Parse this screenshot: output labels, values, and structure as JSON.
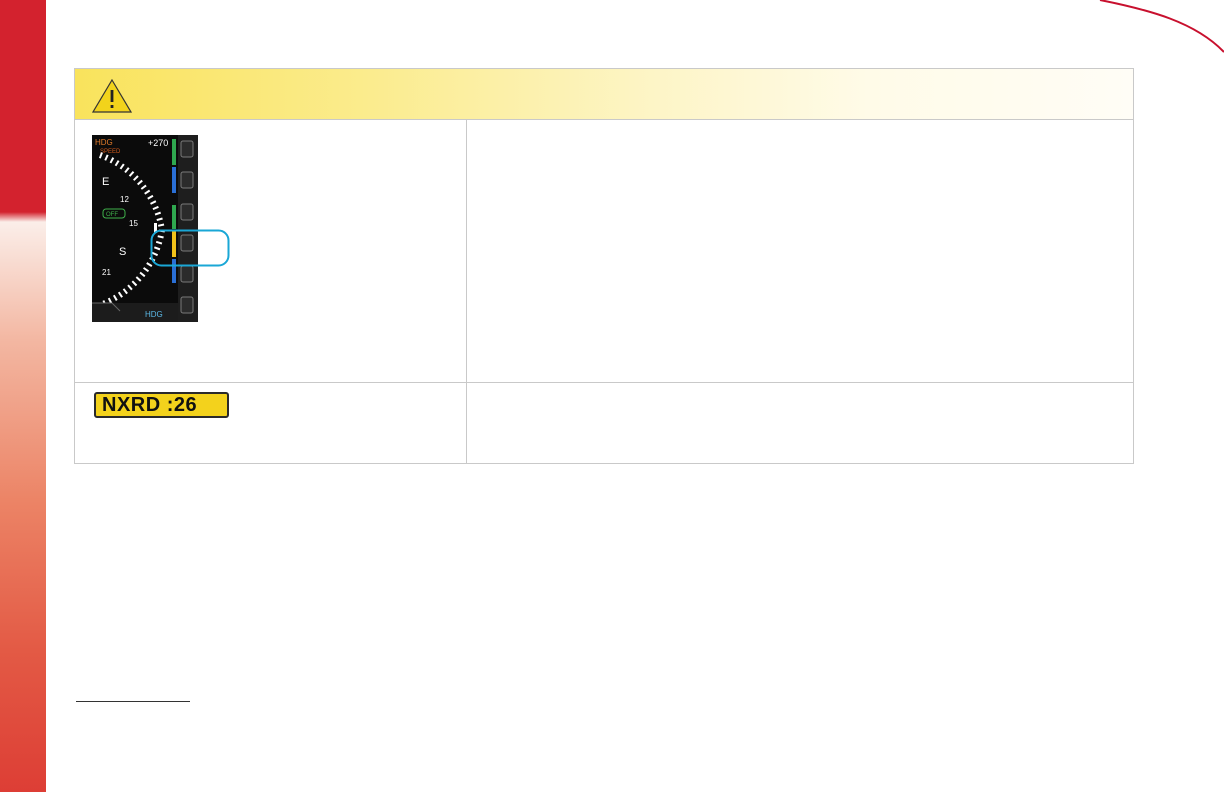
{
  "header": {
    "icon": "warning-triangle-icon",
    "accent_color": "#f9e35c"
  },
  "display": {
    "top_left_label": "HDG",
    "top_left_sub": "SPEED",
    "top_right_value": "+270",
    "compass_labels": [
      "E",
      "12",
      "15",
      "S",
      "21"
    ],
    "bug_label": "OFF",
    "bottom_label": "HDG",
    "highlight_color": "#1aa7d6"
  },
  "nxrd_badge": {
    "text": "NXRD :26",
    "background": "#f3d21c"
  },
  "colors": {
    "edge_bar": "#d3222e",
    "border": "#c9c9c9"
  }
}
